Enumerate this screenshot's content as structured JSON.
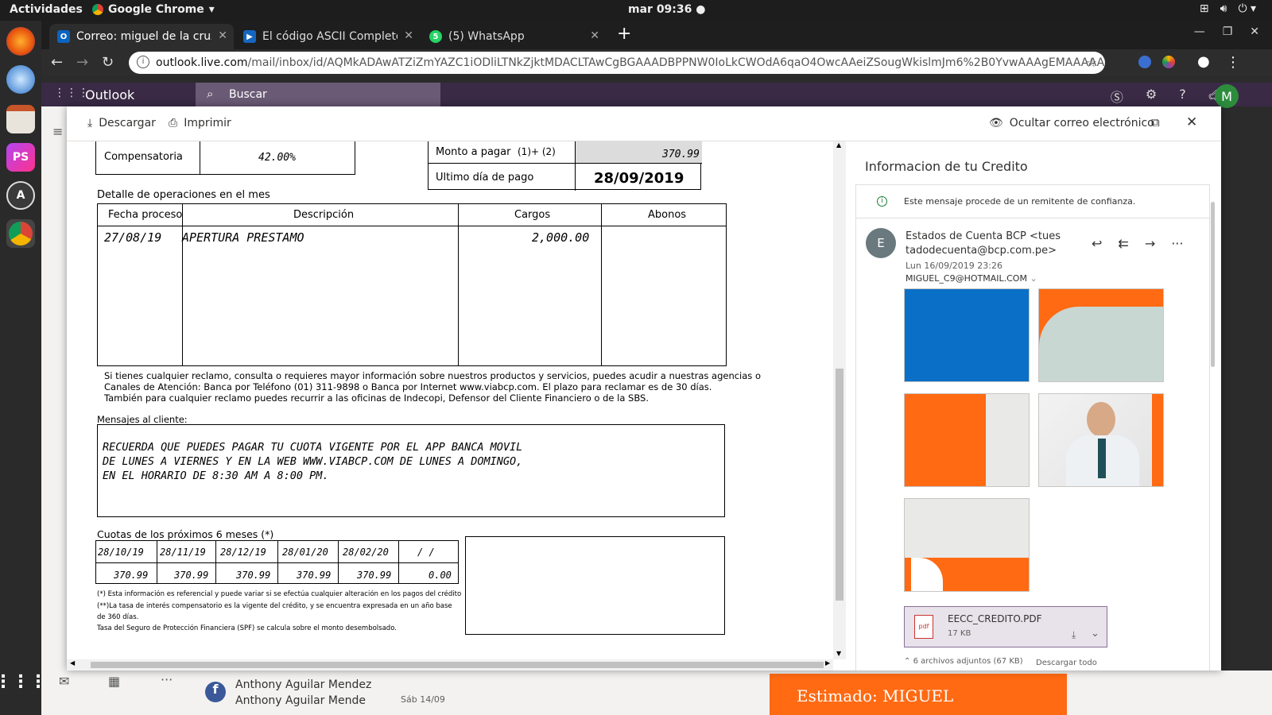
{
  "os": {
    "activities": "Actividades",
    "app_name": "Google Chrome",
    "clock": "mar 09:36"
  },
  "browser": {
    "tabs": [
      {
        "title": "Correo: miguel de la cruz"
      },
      {
        "title": "El código ASCII Completo"
      },
      {
        "title": "(5) WhatsApp"
      }
    ],
    "url_host": "outlook.live.com",
    "url_path": "/mail/inbox/id/AQMkADAwATZiZmYAZC1iODliLTNkZjktMDACLTAwCgBGAAADBPPNW0IoLkCWOdA6qaO4OwcAAeiZSougWkislmJm6%2B0YvwAAAgEMAAAAAeiZSou..."
  },
  "outlook": {
    "brand": "Outlook",
    "search_placeholder": "Buscar",
    "avatar_initial": "M"
  },
  "modal": {
    "download_label": "Descargar",
    "print_label": "Imprimir",
    "hide_email_label": "Ocultar correo electrónico"
  },
  "document": {
    "compensatoria_label": "Compensatoria",
    "compensatoria_value": "42.00%",
    "monto_label": "Monto a pagar",
    "monto_formula": "(1)+ (2)",
    "monto_value": "370.99",
    "ultimo_label": "Ultimo día de pago",
    "ultimo_value": "28/09/2019",
    "detalle_title": "Detalle de operaciones en el mes",
    "ops_headers": [
      "Fecha proceso",
      "Descripción",
      "Cargos",
      "Abonos"
    ],
    "ops_row": {
      "fecha": "27/08/19",
      "descripcion": "APERTURA PRESTAMO",
      "cargos": "2,000.00",
      "abonos": ""
    },
    "reclamo_1": "Si tienes cualquier reclamo, consulta o requieres mayor información sobre nuestros productos y servicios, puedes acudir a nuestras agencias o",
    "reclamo_2": "Canales de Atención: Banca por Teléfono (01) 311-9898 o Banca por Internet www.viabcp.com. El plazo para reclamar es de 30 días.",
    "reclamo_3": "También para cualquier reclamo puedes recurrir a las oficinas de Indecopi, Defensor del Cliente Financiero o de la SBS.",
    "mensajes_title": "Mensajes al cliente:",
    "mensaje_1": "RECUERDA QUE PUEDES PAGAR TU CUOTA VIGENTE POR EL APP BANCA MOVIL",
    "mensaje_2": "DE LUNES A VIERNES Y EN LA WEB WWW.VIABCP.COM DE LUNES A DOMINGO,",
    "mensaje_3": "EN EL HORARIO DE 8:30 AM A 8:00 PM.",
    "cuotas_title": "Cuotas de los próximos 6 meses (*)",
    "cuotas_fechas": [
      "28/10/19",
      "28/11/19",
      "28/12/19",
      "28/01/20",
      "28/02/20",
      "/  /"
    ],
    "cuotas_montos": [
      "370.99",
      "370.99",
      "370.99",
      "370.99",
      "370.99",
      "0.00"
    ],
    "nota_1": "(*) Esta información es referencial y puede variar si se efectúa cualquier alteración en los pagos del crédito",
    "nota_2": "(**)La tasa de interés compensatorio es la vigente del crédito, y se encuentra expresada en un año base",
    "nota_3": "de 360 días.",
    "nota_4": "Tasa del Seguro de Protección Financiera (SPF) se calcula sobre el monto desembolsado."
  },
  "mail": {
    "subject": "Informacion de tu Credito",
    "trust_message": "Este mensaje procede de un remitente de confianza.",
    "sender_initial": "E",
    "sender_name_line1": "Estados de Cuenta BCP <tues",
    "sender_name_line2": "tadodecuenta@bcp.com.pe>",
    "date": "Lun 16/09/2019 23:26",
    "recipient": "MIGUEL_C9@HOTMAIL.COM",
    "attachment_name": "EECC_CREDITO.PDF",
    "attachment_size": "17 KB",
    "attachments_summary": "6 archivos adjuntos (67 KB)",
    "download_all": "Descargar todo"
  },
  "background": {
    "contact_name": "Anthony Aguilar Mendez",
    "contact_name_2": "Anthony Aguilar Mende",
    "contact_date": "Sáb 14/09",
    "preview_text": "Estimado: MIGUEL"
  },
  "colors": {
    "bcp_blue": "#0a6fc7",
    "bcp_orange": "#ff6a13",
    "outlook_header": "#3a2a45"
  }
}
